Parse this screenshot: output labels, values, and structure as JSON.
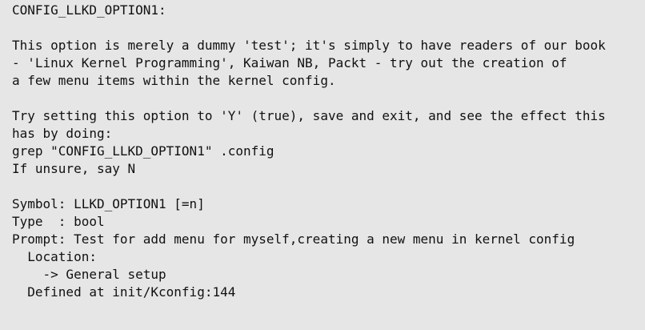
{
  "help_text": {
    "lines": [
      "CONFIG_LLKD_OPTION1:",
      "",
      "This option is merely a dummy 'test'; it's simply to have readers of our book",
      "- 'Linux Kernel Programming', Kaiwan NB, Packt - try out the creation of",
      "a few menu items within the kernel config.",
      "",
      "Try setting this option to 'Y' (true), save and exit, and see the effect this",
      "has by doing:",
      "grep \"CONFIG_LLKD_OPTION1\" .config",
      "If unsure, say N",
      "",
      "Symbol: LLKD_OPTION1 [=n]",
      "Type  : bool",
      "Prompt: Test for add menu for myself,creating a new menu in kernel config",
      "  Location:",
      "    -> General setup",
      "  Defined at init/Kconfig:144"
    ]
  },
  "colors": {
    "background": "#e6e6e6",
    "text": "#111111"
  }
}
